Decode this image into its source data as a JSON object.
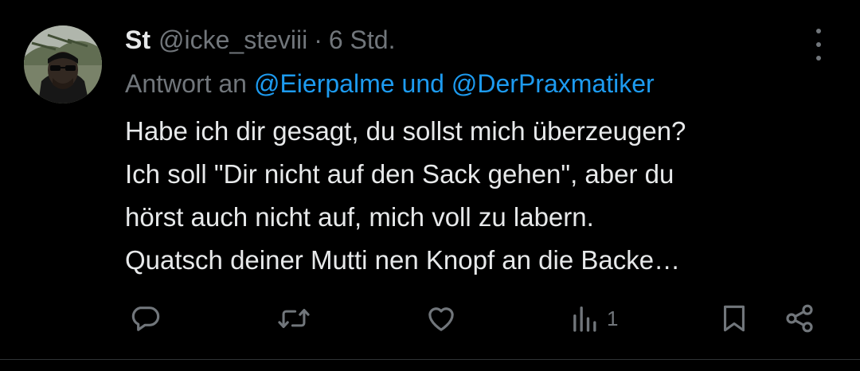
{
  "tweet": {
    "display_name": "St",
    "handle": "@icke_steviii",
    "separator": "·",
    "time": "6 Std.",
    "reply_prefix": "Antwort an",
    "reply_mention_1": "@Eierpalme",
    "reply_conjunction": "und",
    "reply_mention_2": "@DerPraxmatiker",
    "text": "Habe ich dir gesagt, du sollst mich überzeugen?\nIch soll \"Dir nicht auf den Sack gehen\", aber du\nhörst auch nicht auf, mich voll zu labern.\nQuatsch deiner Mutti nen Knopf an die Backe…",
    "views_count": "1"
  },
  "icons": {
    "reply": "reply-bubble-icon",
    "retweet": "retweet-icon",
    "like": "heart-icon",
    "views": "views-bar-chart-icon",
    "bookmark": "bookmark-icon",
    "share": "share-icon",
    "more": "more-dots-icon"
  },
  "colors": {
    "background": "#000000",
    "primary_text": "#e7e9ea",
    "secondary_text": "#71767b",
    "link": "#1d9bf0",
    "divider": "#2f3336"
  }
}
